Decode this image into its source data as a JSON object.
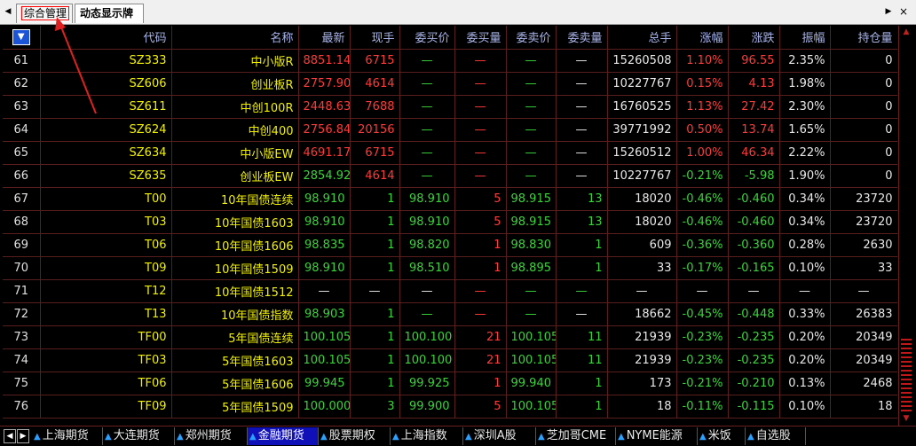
{
  "tabs": [
    {
      "label": "综合管理",
      "highlighted": true
    },
    {
      "label": "动态显示牌",
      "active": true
    }
  ],
  "icons": {
    "scroll_left": "triangle-left-icon",
    "scroll_right": "triangle-right-icon",
    "close": "close-icon"
  },
  "table": {
    "columns": [
      "",
      "代码",
      "名称",
      "最新",
      "现手",
      "委买价",
      "委买量",
      "委卖价",
      "委卖量",
      "总手",
      "涨幅",
      "涨跌",
      "振幅",
      "持仓量"
    ],
    "rows": [
      {
        "idx": "61",
        "code": "SZ333",
        "name": "中小版R",
        "last": "8851.14",
        "vol": "6715",
        "bid": "—",
        "bidv": "—",
        "ask": "—",
        "askv": "—",
        "total": "15260508",
        "pct": "1.10%",
        "chg": "96.55",
        "amp": "2.35%",
        "oi": "0",
        "dir": "up",
        "hand": "red"
      },
      {
        "idx": "62",
        "code": "SZ606",
        "name": "创业板R",
        "last": "2757.90",
        "vol": "4614",
        "bid": "—",
        "bidv": "—",
        "ask": "—",
        "askv": "—",
        "total": "10227767",
        "pct": "0.15%",
        "chg": "4.13",
        "amp": "1.98%",
        "oi": "0",
        "dir": "up",
        "hand": "red"
      },
      {
        "idx": "63",
        "code": "SZ611",
        "name": "中创100R",
        "last": "2448.63",
        "vol": "7688",
        "bid": "—",
        "bidv": "—",
        "ask": "—",
        "askv": "—",
        "total": "16760525",
        "pct": "1.13%",
        "chg": "27.42",
        "amp": "2.30%",
        "oi": "0",
        "dir": "up",
        "hand": "red"
      },
      {
        "idx": "64",
        "code": "SZ624",
        "name": "中创400",
        "last": "2756.84",
        "vol": "20156",
        "bid": "—",
        "bidv": "—",
        "ask": "—",
        "askv": "—",
        "total": "39771992",
        "pct": "0.50%",
        "chg": "13.74",
        "amp": "1.65%",
        "oi": "0",
        "dir": "up",
        "hand": "red"
      },
      {
        "idx": "65",
        "code": "SZ634",
        "name": "中小版EW",
        "last": "4691.17",
        "vol": "6715",
        "bid": "—",
        "bidv": "—",
        "ask": "—",
        "askv": "—",
        "total": "15260512",
        "pct": "1.00%",
        "chg": "46.34",
        "amp": "2.22%",
        "oi": "0",
        "dir": "up",
        "hand": "red"
      },
      {
        "idx": "66",
        "code": "SZ635",
        "name": "创业板EW",
        "last": "2854.92",
        "vol": "4614",
        "bid": "—",
        "bidv": "—",
        "ask": "—",
        "askv": "—",
        "total": "10227767",
        "pct": "-0.21%",
        "chg": "-5.98",
        "amp": "1.90%",
        "oi": "0",
        "dir": "down",
        "hand": "red"
      },
      {
        "idx": "67",
        "code": "T00",
        "name": "10年国债连续",
        "last": "98.910",
        "vol": "1",
        "bid": "98.910",
        "bidv": "5",
        "ask": "98.915",
        "askv": "13",
        "total": "18020",
        "pct": "-0.46%",
        "chg": "-0.460",
        "amp": "0.34%",
        "oi": "23720",
        "dir": "down",
        "hand": "green"
      },
      {
        "idx": "68",
        "code": "T03",
        "name": "10年国债1603",
        "last": "98.910",
        "vol": "1",
        "bid": "98.910",
        "bidv": "5",
        "ask": "98.915",
        "askv": "13",
        "total": "18020",
        "pct": "-0.46%",
        "chg": "-0.460",
        "amp": "0.34%",
        "oi": "23720",
        "dir": "down",
        "hand": "green"
      },
      {
        "idx": "69",
        "code": "T06",
        "name": "10年国债1606",
        "last": "98.835",
        "vol": "1",
        "bid": "98.820",
        "bidv": "1",
        "ask": "98.830",
        "askv": "1",
        "total": "609",
        "pct": "-0.36%",
        "chg": "-0.360",
        "amp": "0.28%",
        "oi": "2630",
        "dir": "down",
        "hand": "green"
      },
      {
        "idx": "70",
        "code": "T09",
        "name": "10年国债1509",
        "last": "98.910",
        "vol": "1",
        "bid": "98.510",
        "bidv": "1",
        "ask": "98.895",
        "askv": "1",
        "total": "33",
        "pct": "-0.17%",
        "chg": "-0.165",
        "amp": "0.10%",
        "oi": "33",
        "dir": "down",
        "hand": "green"
      },
      {
        "idx": "71",
        "code": "T12",
        "name": "10年国债1512",
        "last": "—",
        "vol": "—",
        "bid": "—",
        "bidv": "—",
        "ask": "—",
        "askv": "—",
        "total": "—",
        "pct": "—",
        "chg": "—",
        "amp": "—",
        "oi": "—",
        "dir": "flat",
        "hand": "white"
      },
      {
        "idx": "72",
        "code": "T13",
        "name": "10年国债指数",
        "last": "98.903",
        "vol": "1",
        "bid": "—",
        "bidv": "—",
        "ask": "—",
        "askv": "—",
        "total": "18662",
        "pct": "-0.45%",
        "chg": "-0.448",
        "amp": "0.33%",
        "oi": "26383",
        "dir": "down",
        "hand": "green"
      },
      {
        "idx": "73",
        "code": "TF00",
        "name": "5年国债连续",
        "last": "100.105",
        "vol": "1",
        "bid": "100.100",
        "bidv": "21",
        "ask": "100.105",
        "askv": "11",
        "total": "21939",
        "pct": "-0.23%",
        "chg": "-0.235",
        "amp": "0.20%",
        "oi": "20349",
        "dir": "down",
        "hand": "green"
      },
      {
        "idx": "74",
        "code": "TF03",
        "name": "5年国债1603",
        "last": "100.105",
        "vol": "1",
        "bid": "100.100",
        "bidv": "21",
        "ask": "100.105",
        "askv": "11",
        "total": "21939",
        "pct": "-0.23%",
        "chg": "-0.235",
        "amp": "0.20%",
        "oi": "20349",
        "dir": "down",
        "hand": "green"
      },
      {
        "idx": "75",
        "code": "TF06",
        "name": "5年国债1606",
        "last": "99.945",
        "vol": "1",
        "bid": "99.925",
        "bidv": "1",
        "ask": "99.940",
        "askv": "1",
        "total": "173",
        "pct": "-0.21%",
        "chg": "-0.210",
        "amp": "0.13%",
        "oi": "2468",
        "dir": "down",
        "hand": "green"
      },
      {
        "idx": "76",
        "code": "TF09",
        "name": "5年国债1509",
        "last": "100.000",
        "vol": "3",
        "bid": "99.900",
        "bidv": "5",
        "ask": "100.105",
        "askv": "1",
        "total": "18",
        "pct": "-0.11%",
        "chg": "-0.115",
        "amp": "0.10%",
        "oi": "18",
        "dir": "down",
        "hand": "green"
      }
    ]
  },
  "bottom_tabs": [
    {
      "label": "上海期货"
    },
    {
      "label": "大连期货"
    },
    {
      "label": "郑州期货"
    },
    {
      "label": "金融期货",
      "selected": true
    },
    {
      "label": "股票期权"
    },
    {
      "label": "上海指数"
    },
    {
      "label": "深圳A股"
    },
    {
      "label": "芝加哥CME"
    },
    {
      "label": "NYME能源"
    },
    {
      "label": "米饭"
    },
    {
      "label": "自选股"
    }
  ],
  "colors": {
    "up": "#ff3a3a",
    "down": "#3ad43a",
    "neutral": "#e8e8e8",
    "code": "#f0f000",
    "grid": "#5a1e1e",
    "header": "#a8b4e8",
    "annotation": "#e02020"
  }
}
